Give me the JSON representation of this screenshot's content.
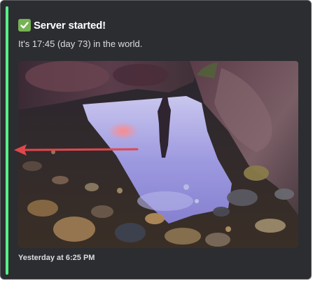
{
  "embed": {
    "title": "Server started!",
    "description": "It's 17:45 (day 73) in the world.",
    "footer": "Yesterday at 6:25 PM",
    "icon": "white-check-mark-icon",
    "accent_color": "#57f287",
    "image": "rock-pool-sky-reflection"
  }
}
